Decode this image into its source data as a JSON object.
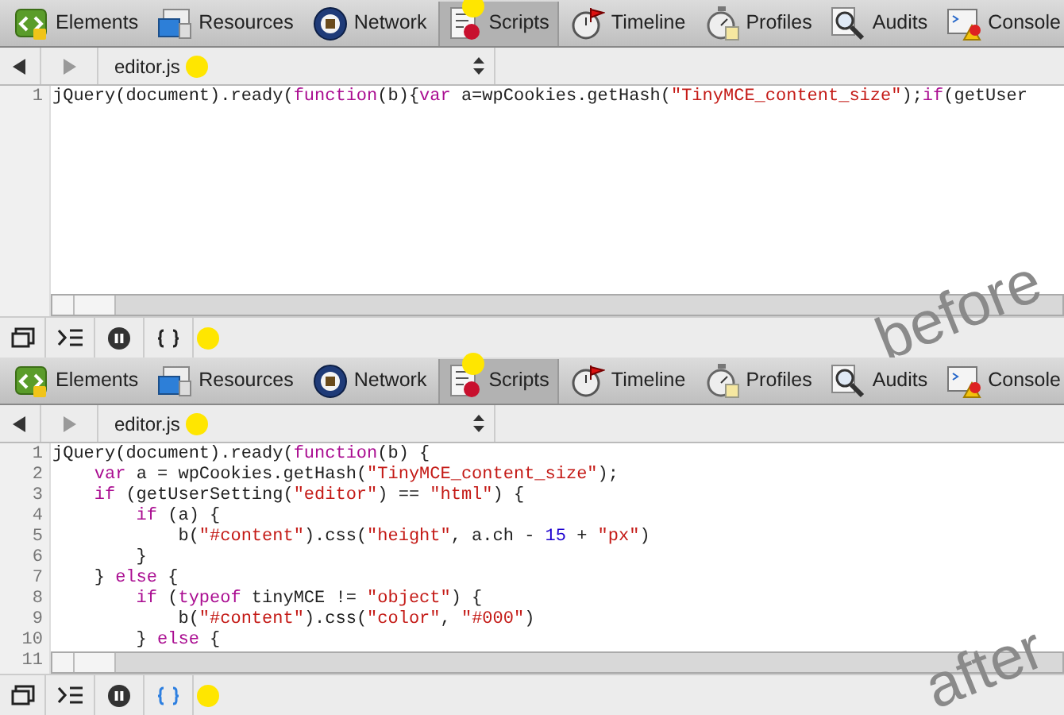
{
  "panels": [
    {
      "caption": "before",
      "tabs": [
        {
          "label": "Elements",
          "kind": "elements",
          "selected": false
        },
        {
          "label": "Resources",
          "kind": "resources",
          "selected": false
        },
        {
          "label": "Network",
          "kind": "network",
          "selected": false
        },
        {
          "label": "Scripts",
          "kind": "scripts",
          "selected": true
        },
        {
          "label": "Timeline",
          "kind": "timeline",
          "selected": false
        },
        {
          "label": "Profiles",
          "kind": "profiles",
          "selected": false
        },
        {
          "label": "Audits",
          "kind": "audits",
          "selected": false
        },
        {
          "label": "Console",
          "kind": "console",
          "selected": false
        }
      ],
      "file": "editor.js",
      "pretty_print": {
        "on": false
      },
      "lines": [
        {
          "number": "1",
          "tokens": [
            {
              "kind": "plain",
              "text": "jQuery(document).ready("
            },
            {
              "kind": "keyword",
              "text": "function"
            },
            {
              "kind": "plain",
              "text": "(b){"
            },
            {
              "kind": "keyword",
              "text": "var"
            },
            {
              "kind": "plain",
              "text": " a=wpCookies.getHash("
            },
            {
              "kind": "string",
              "text": "\"TinyMCE_content_size\""
            },
            {
              "kind": "plain",
              "text": ");"
            },
            {
              "kind": "keyword",
              "text": "if"
            },
            {
              "kind": "plain",
              "text": "(getUser"
            }
          ]
        }
      ]
    },
    {
      "caption": "after",
      "tabs": [
        {
          "label": "Elements",
          "kind": "elements",
          "selected": false
        },
        {
          "label": "Resources",
          "kind": "resources",
          "selected": false
        },
        {
          "label": "Network",
          "kind": "network",
          "selected": false
        },
        {
          "label": "Scripts",
          "kind": "scripts",
          "selected": true
        },
        {
          "label": "Timeline",
          "kind": "timeline",
          "selected": false
        },
        {
          "label": "Profiles",
          "kind": "profiles",
          "selected": false
        },
        {
          "label": "Audits",
          "kind": "audits",
          "selected": false
        },
        {
          "label": "Console",
          "kind": "console",
          "selected": false
        }
      ],
      "file": "editor.js",
      "pretty_print": {
        "on": true
      },
      "lines": [
        {
          "number": "1",
          "tokens": [
            {
              "kind": "plain",
              "text": "jQuery(document).ready("
            },
            {
              "kind": "keyword",
              "text": "function"
            },
            {
              "kind": "plain",
              "text": "(b) {"
            }
          ]
        },
        {
          "number": "2",
          "tokens": [
            {
              "kind": "keyword",
              "text": "    var"
            },
            {
              "kind": "plain",
              "text": " a = wpCookies.getHash("
            },
            {
              "kind": "string",
              "text": "\"TinyMCE_content_size\""
            },
            {
              "kind": "plain",
              "text": ");"
            }
          ]
        },
        {
          "number": "3",
          "tokens": [
            {
              "kind": "keyword",
              "text": "    if"
            },
            {
              "kind": "plain",
              "text": " (getUserSetting("
            },
            {
              "kind": "string",
              "text": "\"editor\""
            },
            {
              "kind": "plain",
              "text": ") == "
            },
            {
              "kind": "string",
              "text": "\"html\""
            },
            {
              "kind": "plain",
              "text": ") {"
            }
          ]
        },
        {
          "number": "4",
          "tokens": [
            {
              "kind": "keyword",
              "text": "        if"
            },
            {
              "kind": "plain",
              "text": " (a) {"
            }
          ]
        },
        {
          "number": "5",
          "tokens": [
            {
              "kind": "plain",
              "text": "            b("
            },
            {
              "kind": "string",
              "text": "\"#content\""
            },
            {
              "kind": "plain",
              "text": ").css("
            },
            {
              "kind": "string",
              "text": "\"height\""
            },
            {
              "kind": "plain",
              "text": ", a.ch - "
            },
            {
              "kind": "number",
              "text": "15"
            },
            {
              "kind": "plain",
              "text": " + "
            },
            {
              "kind": "string",
              "text": "\"px\""
            },
            {
              "kind": "plain",
              "text": ")"
            }
          ]
        },
        {
          "number": "6",
          "tokens": [
            {
              "kind": "plain",
              "text": "        }"
            }
          ]
        },
        {
          "number": "7",
          "tokens": [
            {
              "kind": "plain",
              "text": "    } "
            },
            {
              "kind": "keyword",
              "text": "else"
            },
            {
              "kind": "plain",
              "text": " {"
            }
          ]
        },
        {
          "number": "8",
          "tokens": [
            {
              "kind": "keyword",
              "text": "        if"
            },
            {
              "kind": "plain",
              "text": " ("
            },
            {
              "kind": "keyword",
              "text": "typeof"
            },
            {
              "kind": "plain",
              "text": " tinyMCE != "
            },
            {
              "kind": "string",
              "text": "\"object\""
            },
            {
              "kind": "plain",
              "text": ") {"
            }
          ]
        },
        {
          "number": "9",
          "tokens": [
            {
              "kind": "plain",
              "text": "            b("
            },
            {
              "kind": "string",
              "text": "\"#content\""
            },
            {
              "kind": "plain",
              "text": ").css("
            },
            {
              "kind": "string",
              "text": "\"color\""
            },
            {
              "kind": "plain",
              "text": ", "
            },
            {
              "kind": "string",
              "text": "\"#000\""
            },
            {
              "kind": "plain",
              "text": ")"
            }
          ]
        },
        {
          "number": "10",
          "tokens": [
            {
              "kind": "plain",
              "text": "        } "
            },
            {
              "kind": "keyword",
              "text": "else"
            },
            {
              "kind": "plain",
              "text": " {"
            }
          ]
        },
        {
          "number": "11"
        }
      ]
    }
  ]
}
